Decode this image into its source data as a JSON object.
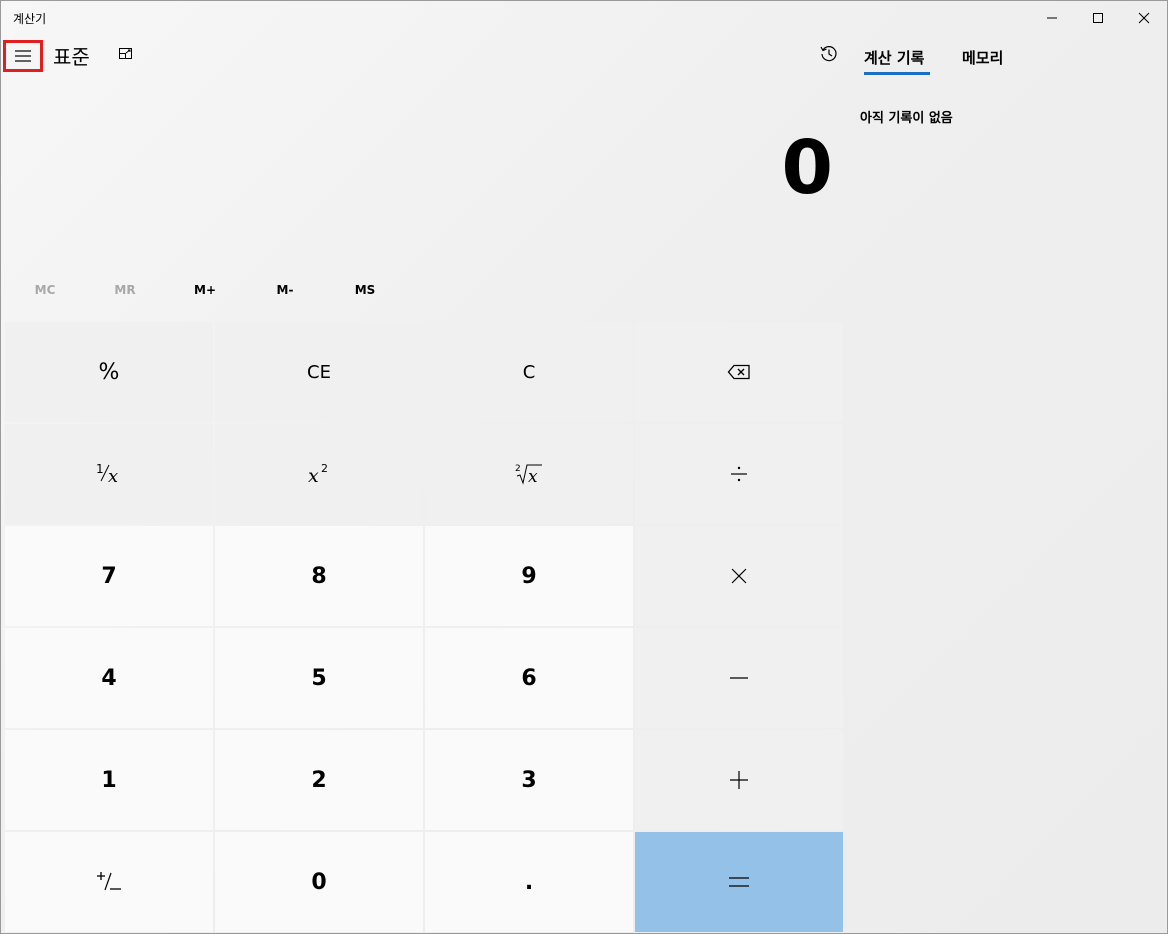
{
  "window": {
    "title": "계산기"
  },
  "header": {
    "mode": "표준"
  },
  "display": {
    "value": "0"
  },
  "memory": {
    "mc": "MC",
    "mr": "MR",
    "mplus": "M+",
    "mminus": "M-",
    "ms": "MS"
  },
  "keys": {
    "percent": "%",
    "ce": "CE",
    "c": "C",
    "seven": "7",
    "eight": "8",
    "nine": "9",
    "four": "4",
    "five": "5",
    "six": "6",
    "one": "1",
    "two": "2",
    "three": "3",
    "zero": "0",
    "decimal": "."
  },
  "panel": {
    "tab_history": "계산 기록",
    "tab_memory": "메모리",
    "empty_message": "아직 기록이 없음"
  },
  "colors": {
    "equals_bg": "#93c1e8",
    "tab_accent": "#1a6fc4",
    "highlight_border": "#e02020"
  },
  "icons": [
    "hamburger-menu-icon",
    "keep-on-top-icon",
    "history-icon",
    "backspace-icon",
    "minimize-icon",
    "maximize-icon",
    "close-icon"
  ]
}
